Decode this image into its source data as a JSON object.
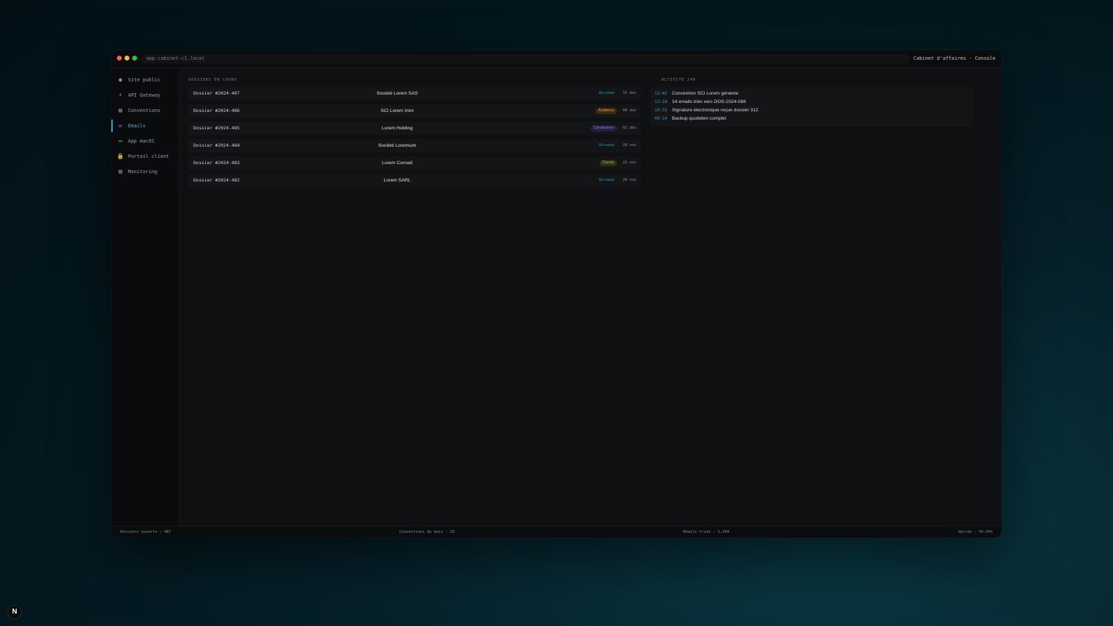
{
  "window": {
    "url": "app.cabinet-c1.local",
    "title": "Cabinet d'affaires · Console"
  },
  "sidebar": {
    "items": [
      {
        "icon": "globe-icon",
        "glyph": "◉",
        "label": "Site public",
        "active": false
      },
      {
        "icon": "lightning-icon",
        "glyph": "⚡",
        "label": "API Gateway",
        "active": false
      },
      {
        "icon": "document-icon",
        "glyph": "▤",
        "label": "Conventions",
        "active": false
      },
      {
        "icon": "mail-icon",
        "glyph": "✉",
        "label": "Emails",
        "active": true
      },
      {
        "icon": "laptop-icon",
        "glyph": "▭",
        "label": "App macOS",
        "active": false
      },
      {
        "icon": "lock-icon",
        "glyph": "🔒",
        "label": "Portail client",
        "active": false
      },
      {
        "icon": "chart-icon",
        "glyph": "▥",
        "label": "Monitoring",
        "active": false
      }
    ]
  },
  "dossiers": {
    "title": "DOSSIERS EN COURS",
    "rows": [
      {
        "id": "Dossier #2024-487",
        "client": "Société Lorem SAS",
        "status": "En cours",
        "status_kind": "encours",
        "date": "15 déc"
      },
      {
        "id": "Dossier #2024-486",
        "client": "SCI Lorem Imm",
        "status": "Audience",
        "status_kind": "audience",
        "date": "08 déc"
      },
      {
        "id": "Dossier #2024-485",
        "client": "Lorem Holding",
        "status": "Conclusions",
        "status_kind": "conclusions",
        "date": "02 déc"
      },
      {
        "id": "Dossier #2024-484",
        "client": "Société Loremium",
        "status": "En cours",
        "status_kind": "encours",
        "date": "28 nov"
      },
      {
        "id": "Dossier #2024-483",
        "client": "Lorem Conseil",
        "status": "Conclu",
        "status_kind": "conclu",
        "date": "22 nov"
      },
      {
        "id": "Dossier #2024-482",
        "client": "Lorem SARL",
        "status": "En cours",
        "status_kind": "encours",
        "date": "20 nov"
      }
    ]
  },
  "activity": {
    "title": "ACTIVITÉ 24H",
    "items": [
      {
        "time": "13:42",
        "text": "Convention SCI Lorem générée"
      },
      {
        "time": "13:18",
        "text": "14 emails triés vers DOS-2024-088"
      },
      {
        "time": "10:55",
        "text": "Signature électronique reçue dossier 312"
      },
      {
        "time": "09:14",
        "text": "Backup quotidien complet"
      }
    ]
  },
  "footer": {
    "dossiers": "Dossiers ouverts : 487",
    "conventions": "Conventions du mois : 23",
    "emails": "Emails triés : 1,204",
    "uptime": "Uptime : 99.99%"
  },
  "corner_badge": "N",
  "colors": {
    "accent": "#2aa6d1",
    "encours": "#2e9fcc",
    "audience_fg": "#f0a23a",
    "audience_bg": "#3a2a10",
    "conclusions_fg": "#9a86e8",
    "conclusions_bg": "#241f3f",
    "conclu_fg": "#b7c93e",
    "conclu_bg": "#2b3112"
  }
}
